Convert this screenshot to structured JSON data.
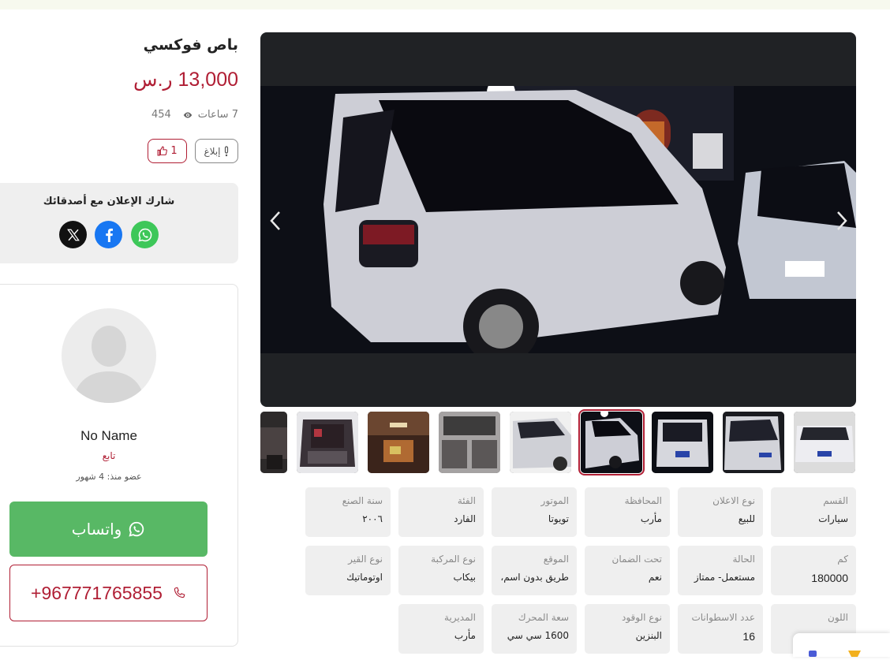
{
  "listing": {
    "title": "باص فوكسي",
    "price": "13,000 ر.س",
    "time_ago": "7 ساعات",
    "views": "454",
    "report_label": "إبلاغ",
    "likes": "1"
  },
  "share": {
    "title": "شارك الإعلان مع أصدقائك",
    "networks": [
      "x-icon",
      "facebook-icon",
      "whatsapp-icon"
    ]
  },
  "seller": {
    "name": "No Name",
    "role": "تابع",
    "member_since": "عضو منذ: 4 شهور",
    "whatsapp_label": "واتساب",
    "phone": "+967771765855"
  },
  "gallery": {
    "thumbnails": [
      "thumb-1",
      "thumb-2",
      "thumb-3",
      "thumb-4",
      "thumb-5",
      "thumb-6",
      "thumb-7",
      "thumb-8",
      "thumb-9"
    ],
    "active_index": 4
  },
  "specs": [
    {
      "label": "القسم",
      "value": "سيارات"
    },
    {
      "label": "نوع الاعلان",
      "value": "للبيع"
    },
    {
      "label": "المحافظة",
      "value": "مأرب"
    },
    {
      "label": "الموتور",
      "value": "تويوتا"
    },
    {
      "label": "الفئة",
      "value": "الفارد"
    },
    {
      "label": "سنة الصنع",
      "value": "٢٠٠٦"
    },
    {
      "label": "كم",
      "value": "180000"
    },
    {
      "label": "الحالة",
      "value": "مستعمل- ممتاز"
    },
    {
      "label": "تحت الضمان",
      "value": "نعم"
    },
    {
      "label": "الموقع",
      "value": "طريق بدون اسم،"
    },
    {
      "label": "نوع المركبة",
      "value": "بيكاب"
    },
    {
      "label": "نوع القير",
      "value": "اوتوماتيك"
    },
    {
      "label": "اللون",
      "value": ""
    },
    {
      "label": "عدد الاسطوانات",
      "value": "16"
    },
    {
      "label": "نوع الوقود",
      "value": "البنزين"
    },
    {
      "label": "سعة المحرك",
      "value": "1600 سي سي"
    },
    {
      "label": "المديرية",
      "value": "مأرب"
    }
  ],
  "colors": {
    "accent": "#b01e34",
    "whatsapp": "#58b865",
    "panel": "#efefef"
  }
}
